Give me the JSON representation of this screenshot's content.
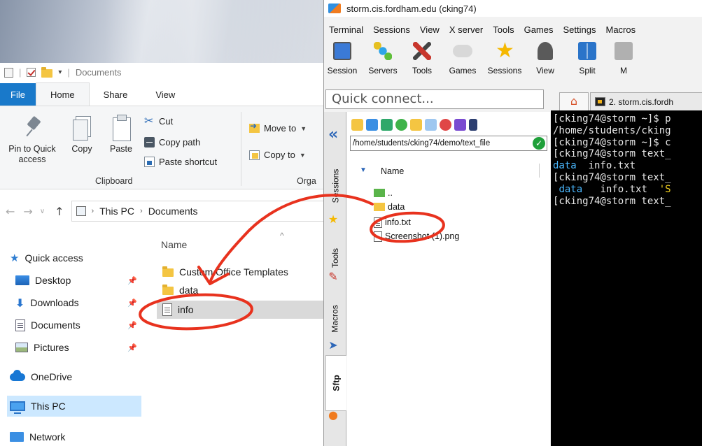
{
  "explorer": {
    "qat_title": "Documents",
    "tabs": {
      "file": "File",
      "home": "Home",
      "share": "Share",
      "view": "View"
    },
    "ribbon": {
      "pin_line1": "Pin to Quick",
      "pin_line2": "access",
      "copy": "Copy",
      "paste": "Paste",
      "cut": "Cut",
      "copy_path": "Copy path",
      "paste_shortcut": "Paste shortcut",
      "clipboard_group": "Clipboard",
      "move_to": "Move to",
      "copy_to": "Copy to",
      "organize_group": "Orga"
    },
    "address": {
      "this_pc": "This PC",
      "documents": "Documents"
    },
    "nav": {
      "quick_access": "Quick access",
      "desktop": "Desktop",
      "downloads": "Downloads",
      "documents": "Documents",
      "pictures": "Pictures",
      "onedrive": "OneDrive",
      "this_pc": "This PC",
      "network": "Network"
    },
    "files": {
      "column_name": "Name",
      "rows": [
        "Custom Office Templates",
        "data",
        "info"
      ]
    }
  },
  "moba": {
    "title": "storm.cis.fordham.edu (cking74)",
    "menu": [
      "Terminal",
      "Sessions",
      "View",
      "X server",
      "Tools",
      "Games",
      "Settings",
      "Macros"
    ],
    "toolbar": [
      "Session",
      "Servers",
      "Tools",
      "Games",
      "Sessions",
      "View",
      "Split",
      "M"
    ],
    "quick_connect_placeholder": "Quick connect...",
    "tab_label": "2. storm.cis.fordh",
    "vtabs": {
      "sessions": "Sessions",
      "tools": "Tools",
      "macros": "Macros",
      "sftp": "Sftp"
    },
    "sftp": {
      "path": "/home/students/cking74/demo/text_file",
      "column_name": "Name",
      "rows": [
        "..",
        "data",
        "info.txt",
        "Screenshot (1).png"
      ]
    },
    "terminal": {
      "lines": [
        "[cking74@storm ~]$ p",
        "/home/students/cking",
        "[cking74@storm ~]$ c",
        "[cking74@storm text_",
        "",
        "[cking74@storm text_",
        "",
        "[cking74@storm text_"
      ],
      "ls1_dir": "data",
      "ls1_file": "info.txt",
      "ls2_dir": "data",
      "ls2_file": "info.txt",
      "ls2_extra": "'S"
    }
  },
  "colors": {
    "annotation_red": "#e8321e",
    "explorer_accent": "#1979ca",
    "terminal_bg": "#000000"
  }
}
